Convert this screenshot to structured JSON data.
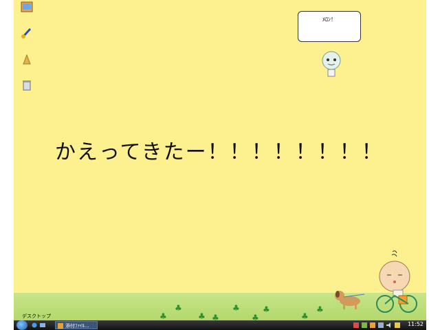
{
  "desktop": {
    "main_text": "かえってきたー！！！！！！！！",
    "bubble_text": "ﾒﾛﾝ！",
    "label_bottom_left": "デスクトップ",
    "colors": {
      "wallpaper": "#fdf08e",
      "grass": "#b3d86c",
      "clover": "#2f8f2f"
    },
    "icons": [
      "picture-icon",
      "paint-icon",
      "folder-icon",
      "recycle-bin-icon"
    ]
  },
  "taskbar": {
    "task_button_label": "添付ﾌｧｲﾙ...",
    "clock": "11:52"
  }
}
